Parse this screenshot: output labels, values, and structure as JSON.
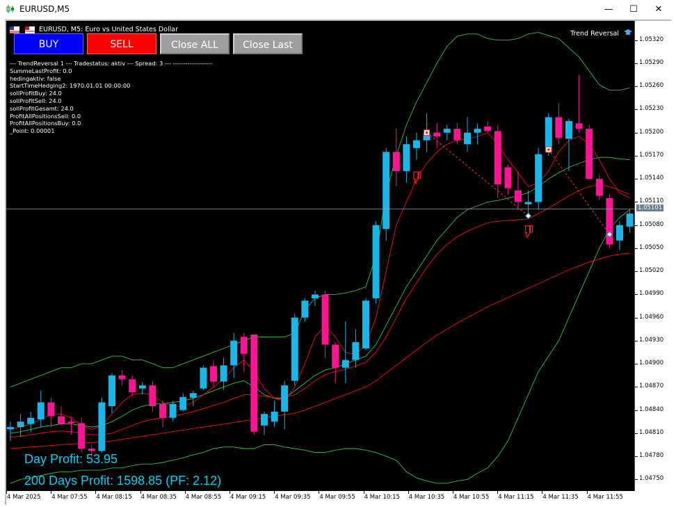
{
  "window": {
    "title": "EURUSD,M5",
    "minimize_icon": "minimize-icon",
    "maximize_icon": "maximize-icon",
    "close_icon": "close-icon"
  },
  "chart_header": {
    "symbol_desc": "EURUSD, M5:  Euro vs United States Dollar",
    "ea_name": "Trend Reversal",
    "ea_icon": "graduation-cap-icon"
  },
  "buttons": {
    "buy": {
      "label": "BUY",
      "color": "#0000ff"
    },
    "sell": {
      "label": "SELL",
      "color": "#ff0000"
    },
    "close_all": {
      "label": "Close ALL",
      "color": "#9e9e9e"
    },
    "close_last": {
      "label": "Close Last",
      "color": "#9e9e9e"
    }
  },
  "info_lines": [
    "--- TrendReversal 1 --- Tradestatus: aktiv --- Spread: 3 --- -------------------",
    "SummeLastProfit: 0.0",
    "hedingaktiv: false",
    "StartTimeHedging2: 1970.01.01 00:00:00",
    "sollProfitBuy: 24.0",
    "sollProfitSell: 24.0",
    "sollProfitGesamt: 24.0",
    "ProfitAllPositionsSell: 0.0",
    "ProfitAllPositionsBuy: 0.0",
    "_Point: 0.00001"
  ],
  "profit": {
    "day": "Day Profit: 53.95",
    "days200": "200 Days Profit: 1598.85 (PF: 2.12)"
  },
  "current_price": "1.05101",
  "price_ticks": [
    "1.05320",
    "1.05290",
    "1.05260",
    "1.05230",
    "1.05200",
    "1.05170",
    "1.05140",
    "1.05110",
    "1.05080",
    "1.05050",
    "1.05020",
    "1.04990",
    "1.04960",
    "1.04930",
    "1.04900",
    "1.04870",
    "1.04840",
    "1.04810",
    "1.04780",
    "1.04750"
  ],
  "time_ticks": [
    "4 Mar 2025",
    "4 Mar 07:55",
    "4 Mar 08:15",
    "4 Mar 08:35",
    "4 Mar 08:55",
    "4 Mar 09:15",
    "4 Mar 09:35",
    "4 Mar 09:55",
    "4 Mar 10:15",
    "4 Mar 10:35",
    "4 Mar 10:55",
    "4 Mar 11:15",
    "4 Mar 11:35",
    "4 Mar 11:55"
  ],
  "colors": {
    "bull": "#1ab6e8",
    "bear": "#ff1493",
    "band": "#35c24a",
    "ma": "#e01010",
    "grid": "#ffffff"
  },
  "chart_data": {
    "type": "candlestick",
    "symbol": "EURUSD",
    "timeframe": "M5",
    "ylim": [
      1.04735,
      1.05345
    ],
    "bid_line": 1.05101,
    "candles": [
      [
        1.04815,
        1.04825,
        1.048,
        1.04818
      ],
      [
        1.04818,
        1.04835,
        1.04805,
        1.04825
      ],
      [
        1.04822,
        1.04838,
        1.04812,
        1.0483
      ],
      [
        1.04828,
        1.04865,
        1.04818,
        1.0485
      ],
      [
        1.0485,
        1.04856,
        1.04818,
        1.04832
      ],
      [
        1.04832,
        1.04845,
        1.0482,
        1.04822
      ],
      [
        1.04825,
        1.04832,
        1.04808,
        1.04823
      ],
      [
        1.04823,
        1.0483,
        1.04785,
        1.0479
      ],
      [
        1.0479,
        1.04795,
        1.0478,
        1.04787
      ],
      [
        1.04787,
        1.04856,
        1.04785,
        1.0485
      ],
      [
        1.04845,
        1.04888,
        1.04836,
        1.04885
      ],
      [
        1.04885,
        1.04892,
        1.04872,
        1.0488
      ],
      [
        1.0488,
        1.04885,
        1.04858,
        1.04863
      ],
      [
        1.04868,
        1.04876,
        1.0486,
        1.04872
      ],
      [
        1.04872,
        1.04878,
        1.04838,
        1.04845
      ],
      [
        1.04848,
        1.04852,
        1.04818,
        1.0483
      ],
      [
        1.0483,
        1.04852,
        1.04826,
        1.04848
      ],
      [
        1.0484,
        1.04862,
        1.04838,
        1.04857
      ],
      [
        1.04856,
        1.04865,
        1.04845,
        1.04862
      ],
      [
        1.04868,
        1.04898,
        1.04866,
        1.04895
      ],
      [
        1.04897,
        1.04904,
        1.0487,
        1.04877
      ],
      [
        1.04877,
        1.04908,
        1.04866,
        1.04898
      ],
      [
        1.04898,
        1.0494,
        1.04882,
        1.0493
      ],
      [
        1.04935,
        1.0494,
        1.0489,
        1.04913
      ],
      [
        1.04938,
        1.04938,
        1.04808,
        1.04812
      ],
      [
        1.0482,
        1.04838,
        1.04808,
        1.04835
      ],
      [
        1.04825,
        1.04852,
        1.04818,
        1.04838
      ],
      [
        1.04838,
        1.04878,
        1.04815,
        1.04872
      ],
      [
        1.04878,
        1.04965,
        1.04872,
        1.0496
      ],
      [
        1.0496,
        1.04985,
        1.04955,
        1.04982
      ],
      [
        1.04985,
        1.04995,
        1.04975,
        1.0499
      ],
      [
        1.0499,
        1.04995,
        1.04908,
        1.04925
      ],
      [
        1.04925,
        1.04928,
        1.04875,
        1.04895
      ],
      [
        1.04895,
        1.04955,
        1.04875,
        1.04905
      ],
      [
        1.04905,
        1.04945,
        1.04895,
        1.04928
      ],
      [
        1.0492,
        1.04985,
        1.04918,
        1.04982
      ],
      [
        1.04985,
        1.05085,
        1.04978,
        1.0508
      ],
      [
        1.05075,
        1.0518,
        1.0506,
        1.05175
      ],
      [
        1.05175,
        1.05205,
        1.0513,
        1.0515
      ],
      [
        1.0515,
        1.05195,
        1.05135,
        1.05185
      ],
      [
        1.0518,
        1.052,
        1.05165,
        1.0519
      ],
      [
        1.0519,
        1.05225,
        1.05175,
        1.052
      ],
      [
        1.052,
        1.05212,
        1.0518,
        1.05195
      ],
      [
        1.052,
        1.0521,
        1.0519,
        1.05205
      ],
      [
        1.05205,
        1.05212,
        1.05185,
        1.0519
      ],
      [
        1.05185,
        1.0522,
        1.05175,
        1.052
      ],
      [
        1.052,
        1.05212,
        1.05185,
        1.05205
      ],
      [
        1.05208,
        1.05215,
        1.052,
        1.05202
      ],
      [
        1.05202,
        1.0521,
        1.05115,
        1.05133
      ],
      [
        1.05155,
        1.05158,
        1.0512,
        1.05128
      ],
      [
        1.05125,
        1.0515,
        1.051,
        1.0511
      ],
      [
        1.05107,
        1.05125,
        1.05095,
        1.0511
      ],
      [
        1.0511,
        1.0518,
        1.051,
        1.05172
      ],
      [
        1.05175,
        1.05225,
        1.0517,
        1.0522
      ],
      [
        1.0522,
        1.05238,
        1.05185,
        1.05193
      ],
      [
        1.05192,
        1.05218,
        1.0515,
        1.05215
      ],
      [
        1.05212,
        1.05275,
        1.052,
        1.05205
      ],
      [
        1.05205,
        1.0521,
        1.0514,
        1.0514
      ],
      [
        1.0514,
        1.05145,
        1.05112,
        1.05118
      ],
      [
        1.05115,
        1.0512,
        1.0505,
        1.05055
      ],
      [
        1.0506,
        1.05085,
        1.05048,
        1.0508
      ],
      [
        1.05078,
        1.051,
        1.0507,
        1.05095
      ]
    ],
    "bands_upper": [
      1.0487,
      1.04875,
      1.0488,
      1.04885,
      1.0489,
      1.04895,
      1.04895,
      1.049,
      1.049,
      1.04905,
      1.0491,
      1.0491,
      1.04905,
      1.04905,
      1.049,
      1.04895,
      1.04895,
      1.049,
      1.04905,
      1.0491,
      1.04915,
      1.0492,
      1.04925,
      1.0493,
      1.04935,
      1.04935,
      1.04935,
      1.04935,
      1.0494,
      1.0497,
      1.04985,
      1.0499,
      1.0499,
      1.04992,
      1.04995,
      1.05,
      1.0504,
      1.0512,
      1.0517,
      1.0521,
      1.0524,
      1.05265,
      1.0529,
      1.05312,
      1.05325,
      1.05328,
      1.05328,
      1.05322,
      1.0532,
      1.0532,
      1.05322,
      1.05328,
      1.0533,
      1.05326,
      1.05322,
      1.0531,
      1.05298,
      1.0528,
      1.05262,
      1.05255,
      1.05255,
      1.05258
    ],
    "bands_mid": [
      1.0481,
      1.04812,
      1.04815,
      1.04818,
      1.0482,
      1.04822,
      1.04822,
      1.0482,
      1.04818,
      1.0482,
      1.04825,
      1.04832,
      1.0484,
      1.04845,
      1.04848,
      1.04848,
      1.0485,
      1.04852,
      1.04855,
      1.0486,
      1.04865,
      1.0487,
      1.04875,
      1.04878,
      1.0487,
      1.0486,
      1.04855,
      1.04855,
      1.04865,
      1.04875,
      1.04885,
      1.04892,
      1.04895,
      1.049,
      1.04905,
      1.0491,
      1.04925,
      1.0495,
      1.04975,
      1.05,
      1.0502,
      1.0504,
      1.0506,
      1.05075,
      1.0509,
      1.051,
      1.05105,
      1.0511,
      1.05112,
      1.05115,
      1.05118,
      1.05122,
      1.0513,
      1.0514,
      1.05148,
      1.05155,
      1.0516,
      1.05165,
      1.05168,
      1.05168,
      1.05166,
      1.05165
    ],
    "bands_lower": [
      1.04745,
      1.0475,
      1.04752,
      1.04755,
      1.04758,
      1.0476,
      1.0476,
      1.04762,
      1.04762,
      1.04762,
      1.04765,
      1.04765,
      1.04768,
      1.0477,
      1.0477,
      1.04772,
      1.04775,
      1.04778,
      1.04782,
      1.04785,
      1.0479,
      1.04792,
      1.04792,
      1.0479,
      1.0479,
      1.04795,
      1.04795,
      1.04792,
      1.0479,
      1.04788,
      1.04785,
      1.04785,
      1.04788,
      1.0479,
      1.0479,
      1.04788,
      1.04785,
      1.0478,
      1.04775,
      1.0476,
      1.04752,
      1.04748,
      1.04745,
      1.04745,
      1.04748,
      1.0475,
      1.04758,
      1.04765,
      1.0478,
      1.048,
      1.0483,
      1.0486,
      1.0489,
      1.0491,
      1.0493,
      1.0496,
      1.0499,
      1.0502,
      1.0505,
      1.05075,
      1.0509,
      1.051
    ],
    "ma_fast": [
      1.04815,
      1.04818,
      1.04822,
      1.04828,
      1.04835,
      1.04835,
      1.0483,
      1.0482,
      1.04815,
      1.0482,
      1.04835,
      1.0485,
      1.0486,
      1.04862,
      1.0486,
      1.0485,
      1.04845,
      1.04845,
      1.0485,
      1.0486,
      1.0487,
      1.0488,
      1.04895,
      1.04905,
      1.0489,
      1.04868,
      1.04855,
      1.04852,
      1.0487,
      1.049,
      1.04935,
      1.0495,
      1.04935,
      1.04915,
      1.04912,
      1.04925,
      1.0496,
      1.0502,
      1.0508,
      1.0511,
      1.0514,
      1.0516,
      1.05175,
      1.05185,
      1.0519,
      1.05192,
      1.05195,
      1.052,
      1.05185,
      1.05165,
      1.05148,
      1.0513,
      1.05135,
      1.0515,
      1.05175,
      1.0519,
      1.05195,
      1.05185,
      1.05165,
      1.0514,
      1.05122,
      1.05115
    ],
    "ma_mid": [
      1.04805,
      1.04806,
      1.04808,
      1.0481,
      1.04812,
      1.04813,
      1.04812,
      1.0481,
      1.04808,
      1.04808,
      1.0481,
      1.04815,
      1.0482,
      1.04825,
      1.04828,
      1.0483,
      1.04832,
      1.04835,
      1.04838,
      1.04842,
      1.04846,
      1.0485,
      1.04855,
      1.0486,
      1.0486,
      1.04858,
      1.04856,
      1.04856,
      1.0486,
      1.04868,
      1.04878,
      1.04886,
      1.0489,
      1.04893,
      1.04897,
      1.04902,
      1.04915,
      1.04935,
      1.0496,
      1.04985,
      1.05005,
      1.05025,
      1.05042,
      1.05055,
      1.05065,
      1.05072,
      1.05078,
      1.05083,
      1.05085,
      1.05086,
      1.05087,
      1.05088,
      1.05095,
      1.05102,
      1.0511,
      1.05118,
      1.05125,
      1.0513,
      1.05133,
      1.0513,
      1.05125,
      1.0512
    ],
    "ma_slow": [
      1.0479,
      1.04791,
      1.04792,
      1.04793,
      1.04794,
      1.04795,
      1.04796,
      1.04797,
      1.04798,
      1.04799,
      1.048,
      1.04802,
      1.04804,
      1.04806,
      1.04808,
      1.0481,
      1.04812,
      1.04814,
      1.04816,
      1.04818,
      1.0482,
      1.04822,
      1.04824,
      1.04826,
      1.04828,
      1.0483,
      1.04832,
      1.04834,
      1.04836,
      1.0484,
      1.04845,
      1.0485,
      1.04855,
      1.0486,
      1.04865,
      1.0487,
      1.04878,
      1.04888,
      1.04898,
      1.04908,
      1.04918,
      1.04928,
      1.04937,
      1.04945,
      1.04953,
      1.0496,
      1.04967,
      1.04974,
      1.0498,
      1.04986,
      1.04992,
      1.04998,
      1.05004,
      1.0501,
      1.05016,
      1.05022,
      1.05027,
      1.05032,
      1.05036,
      1.0504,
      1.05042,
      1.05044
    ],
    "trade_markers": [
      {
        "index": 41,
        "price": 1.052,
        "kind": "sell-entry"
      },
      {
        "index": 53,
        "price": 1.05178,
        "kind": "sell-entry"
      },
      {
        "index": 51,
        "price": 1.05092,
        "kind": "close"
      },
      {
        "index": 59,
        "price": 1.05068,
        "kind": "close"
      }
    ],
    "trade_lines": [
      {
        "from_index": 41,
        "from_price": 1.052,
        "to_index": 51,
        "to_price": 1.05092
      },
      {
        "from_index": 53,
        "from_price": 1.05178,
        "to_index": 59,
        "to_price": 1.05068
      }
    ],
    "thumb_markers": [
      {
        "index": 40,
        "price": 1.0514,
        "kind": "thumbs-down-icon"
      },
      {
        "index": 51,
        "price": 1.0507,
        "kind": "thumbs-down-icon"
      }
    ]
  }
}
